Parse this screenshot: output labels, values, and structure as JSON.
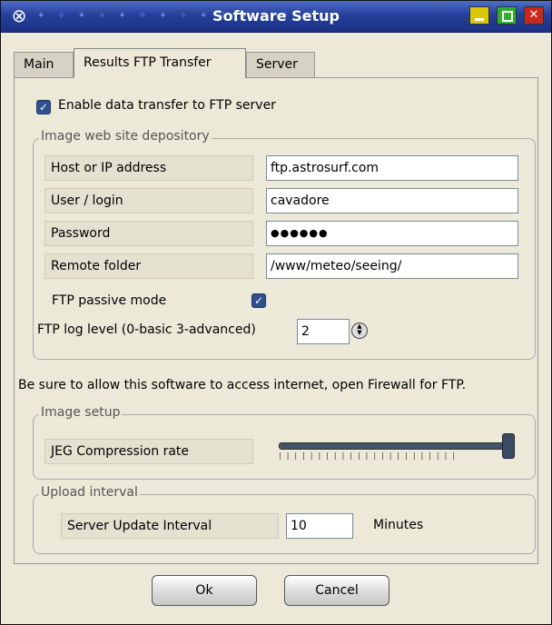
{
  "window": {
    "title": "Software Setup"
  },
  "tabs": [
    {
      "label": "Main"
    },
    {
      "label": "Results FTP Transfer"
    },
    {
      "label": "Server"
    }
  ],
  "enable_transfer": {
    "label": "Enable data transfer to FTP server",
    "checked": true
  },
  "depository": {
    "legend": "Image web site depository",
    "fields": [
      {
        "label": "Host or IP address",
        "value": "ftp.astrosurf.com"
      },
      {
        "label": "User / login",
        "value": "cavadore"
      },
      {
        "label": "Password",
        "value": "●●●●●●"
      },
      {
        "label": "Remote folder",
        "value": "/www/meteo/seeing/"
      }
    ],
    "passive": {
      "label": "FTP passive mode",
      "checked": true
    },
    "log_level": {
      "label": "FTP log level (0-basic 3-advanced)",
      "value": "2"
    }
  },
  "firewall_note": "Be sure to allow this software to access internet, open Firewall for FTP.",
  "image_setup": {
    "legend": "Image setup",
    "label": "JEG Compression rate",
    "level_fraction": 1.0
  },
  "upload_interval": {
    "legend": "Upload interval",
    "label": "Server Update Interval",
    "value": "10",
    "unit": "Minutes"
  },
  "buttons": {
    "ok": "Ok",
    "cancel": "Cancel"
  },
  "colors": {
    "titlebar": "#25409b",
    "accent": "#2f4f8f"
  }
}
